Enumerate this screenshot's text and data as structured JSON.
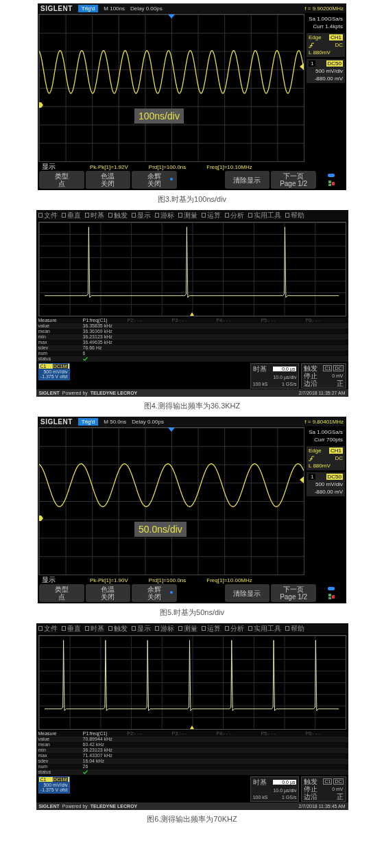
{
  "figures": [
    {
      "kind": "siglent",
      "brand": "SIGLENT",
      "status": "Trig'd",
      "timebase": "M 100ns",
      "delay": "Delay 0.00ps",
      "frequency": "f = 9.90200MHz",
      "sample_rate": "Sa 1.00GSa/s",
      "memory": "Curr 1.4kpts",
      "trigger": {
        "type": "Edge",
        "source": "CH1",
        "coupling": "DC",
        "level": "L  880mV"
      },
      "channel": {
        "number": "1",
        "coupling": "DC50",
        "scale": "500 mV/div",
        "offset": "-880.00 mV"
      },
      "overlay": "100ns/div",
      "menu_title": "显示",
      "measurements": [
        "Pk-Pk[1]=1.92V",
        "Prd[1]=100.0ns",
        "Freq[1]=10.10MHz"
      ],
      "softkeys": [
        {
          "kind": "key",
          "lines": [
            "类型",
            "点"
          ],
          "marked": false
        },
        {
          "kind": "key",
          "lines": [
            "色温",
            "关闭"
          ],
          "marked": false
        },
        {
          "kind": "key",
          "lines": [
            "余辉",
            "关闭"
          ],
          "marked": true
        },
        {
          "kind": "blank"
        },
        {
          "kind": "key",
          "lines": [
            "清除显示"
          ],
          "marked": false
        },
        {
          "kind": "key",
          "lines": [
            "下一页",
            "Page 1/2"
          ],
          "marked": false
        }
      ],
      "caption": "图3.时基为100ns/div"
    },
    {
      "kind": "lecroy",
      "menu": [
        "文件",
        "垂直",
        "时基",
        "触发",
        "显示",
        "游标",
        "测量",
        "运算",
        "分析",
        "实用工具",
        "帮助"
      ],
      "measure_header": [
        "Measure",
        "P1:freq(C1)",
        "P2:- - -",
        "P3:- - -",
        "P4:- - -",
        "P5:- - -",
        "P6:- - -"
      ],
      "measure_rows": [
        {
          "kind": "text",
          "label": "value",
          "value": "36.35835 kHz"
        },
        {
          "kind": "text",
          "label": "mean",
          "value": "36.36369 kHz"
        },
        {
          "kind": "text",
          "label": "min",
          "value": "36.23123 kHz"
        },
        {
          "kind": "text",
          "label": "max",
          "value": "36.49635 kHz"
        },
        {
          "kind": "text",
          "label": "sdev",
          "value": "76.66 Hz"
        },
        {
          "kind": "text",
          "label": "num",
          "value": "6"
        },
        {
          "kind": "check",
          "label": "status"
        }
      ],
      "channel": {
        "name": "C1",
        "coupling": "DC1M",
        "scale": "500 mV/div",
        "offset": "-1.375 V ofst"
      },
      "timebase": {
        "title": "时基",
        "delay": "0.0 µs",
        "scale": "10.0 µs/div",
        "samples": "100 kS",
        "rate": "1 GS/s"
      },
      "trigger": {
        "title": "触发",
        "source": "C1",
        "coupling": "DC",
        "mode": "停止",
        "level": "0 mV",
        "type": "边沿",
        "slope": "正"
      },
      "footer": {
        "brand": "SIGLENT",
        "powered": "Powered by",
        "partner": "TELEDYNE LECROY",
        "timestamp": "2/7/2018 11:35:27 AM"
      },
      "caption": "图4.测得输出频率为36.3KHZ"
    },
    {
      "kind": "siglent",
      "brand": "SIGLENT",
      "status": "Trig'd",
      "timebase": "M 50.0ns",
      "delay": "Delay 0.00ps",
      "frequency": "f = 9.80401MHz",
      "sample_rate": "Sa 1.00GSa/s",
      "memory": "Curr 700pts",
      "trigger": {
        "type": "Edge",
        "source": "CH1",
        "coupling": "DC",
        "level": "L  880mV"
      },
      "channel": {
        "number": "1",
        "coupling": "DC50",
        "scale": "500 mV/div",
        "offset": "-880.00 mV"
      },
      "overlay": "50.0ns/div",
      "menu_title": "显示",
      "measurements": [
        "Pk-Pk[1]=1.90V",
        "Prd[1]=100.0ns",
        "Freq[1]=10.00MHz"
      ],
      "softkeys": [
        {
          "kind": "key",
          "lines": [
            "类型",
            "点"
          ],
          "marked": false
        },
        {
          "kind": "key",
          "lines": [
            "色温",
            "关闭"
          ],
          "marked": false
        },
        {
          "kind": "key",
          "lines": [
            "余辉",
            "关闭"
          ],
          "marked": true
        },
        {
          "kind": "blank"
        },
        {
          "kind": "key",
          "lines": [
            "清除显示"
          ],
          "marked": false
        },
        {
          "kind": "key",
          "lines": [
            "下一页",
            "Page 1/2"
          ],
          "marked": false
        }
      ],
      "caption": "图5.时基为50ns/div"
    },
    {
      "kind": "lecroy",
      "menu": [
        "文件",
        "垂直",
        "时基",
        "触发",
        "显示",
        "游标",
        "测量",
        "运算",
        "分析",
        "实用工具",
        "帮助"
      ],
      "measure_header": [
        "Measure",
        "P1:freq(C1)",
        "P2:- - -",
        "P3:- - -",
        "P4:- - -",
        "P5:- - -",
        "P6:- - -"
      ],
      "measure_rows": [
        {
          "kind": "text",
          "label": "value",
          "value": "70.89944 kHz"
        },
        {
          "kind": "text",
          "label": "mean",
          "value": "60.42 kHz"
        },
        {
          "kind": "text",
          "label": "min",
          "value": "36.23123 kHz"
        },
        {
          "kind": "text",
          "label": "max",
          "value": "71.43307 kHz"
        },
        {
          "kind": "text",
          "label": "sdev",
          "value": "16.04 kHz"
        },
        {
          "kind": "text",
          "label": "num",
          "value": "26"
        },
        {
          "kind": "check",
          "label": "status"
        }
      ],
      "channel": {
        "name": "C1",
        "coupling": "DC1M",
        "scale": "500 mV/div",
        "offset": "-1.375 V ofst"
      },
      "timebase": {
        "title": "时基",
        "delay": "0.0 µs",
        "scale": "10.0 µs/div",
        "samples": "100 kS",
        "rate": "1 GS/s"
      },
      "trigger": {
        "title": "触发",
        "source": "C1",
        "coupling": "DC",
        "mode": "停止",
        "level": "0 mV",
        "type": "边沿",
        "slope": "正"
      },
      "footer": {
        "brand": "SIGLENT",
        "powered": "Powered by",
        "partner": "TELEDYNE LECROY",
        "timestamp": "2/7/2018 11:35:45 AM"
      },
      "caption": "图6.测得输出频率为70KHZ"
    }
  ]
}
